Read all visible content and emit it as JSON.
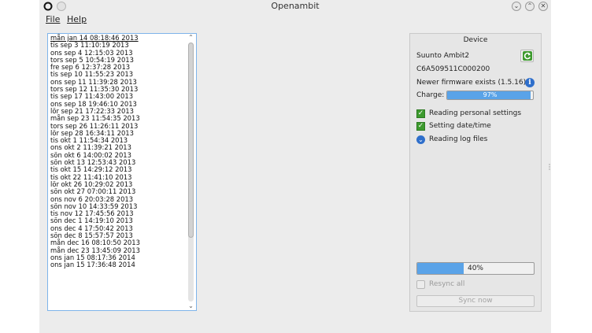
{
  "window": {
    "title": "Openambit"
  },
  "menu": {
    "file": "File",
    "help": "Help"
  },
  "log_entries": [
    "mån jan 14 08:18:46 2013",
    "tis sep 3 11:10:19 2013",
    "ons sep 4 12:15:03 2013",
    "tors sep 5 10:54:19 2013",
    "fre sep 6 12:37:28 2013",
    "tis sep 10 11:55:23 2013",
    "ons sep 11 11:39:28 2013",
    "tors sep 12 11:35:30 2013",
    "tis sep 17 11:43:00 2013",
    "ons sep 18 19:46:10 2013",
    "lör sep 21 17:22:33 2013",
    "mån sep 23 11:54:35 2013",
    "tors sep 26 11:26:11 2013",
    "lör sep 28 16:34:11 2013",
    "tis okt 1 11:54:34 2013",
    "ons okt 2 11:39:21 2013",
    "sön okt 6 14:00:02 2013",
    "sön okt 13 12:53:43 2013",
    "tis okt 15 14:29:12 2013",
    "tis okt 22 11:41:10 2013",
    "lör okt 26 10:29:02 2013",
    "sön okt 27 07:00:11 2013",
    "ons nov 6 20:03:28 2013",
    "sön nov 10 14:33:59 2013",
    "tis nov 12 17:45:56 2013",
    "sön dec 1 14:19:10 2013",
    "ons dec 4 17:50:42 2013",
    "sön dec 8 15:57:57 2013",
    "mån dec 16 08:10:50 2013",
    "mån dec 23 13:45:09 2013",
    "ons jan 15 08:17:36 2014",
    "ons jan 15 17:36:48 2014"
  ],
  "device": {
    "heading": "Device",
    "name": "Suunto Ambit2",
    "serial": "C6A509511C000200",
    "firmware_notice": "Newer firmware exists (1.5.16)",
    "charge_label": "Charge:",
    "charge_text": "97%",
    "charge_value": 0.97,
    "steps": [
      {
        "label": "Reading personal settings",
        "status": "done"
      },
      {
        "label": "Setting date/time",
        "status": "done"
      },
      {
        "label": "Reading log files",
        "status": "in-progress"
      }
    ],
    "progress_text": "40%",
    "progress_value": 0.4,
    "resync_label": "Resync all",
    "sync_button": "Sync now"
  },
  "colors": {
    "accent": "#5aa3e8",
    "check": "#3d9a2e",
    "busy": "#2f6fcb",
    "list_border": "#7eb4ea"
  }
}
